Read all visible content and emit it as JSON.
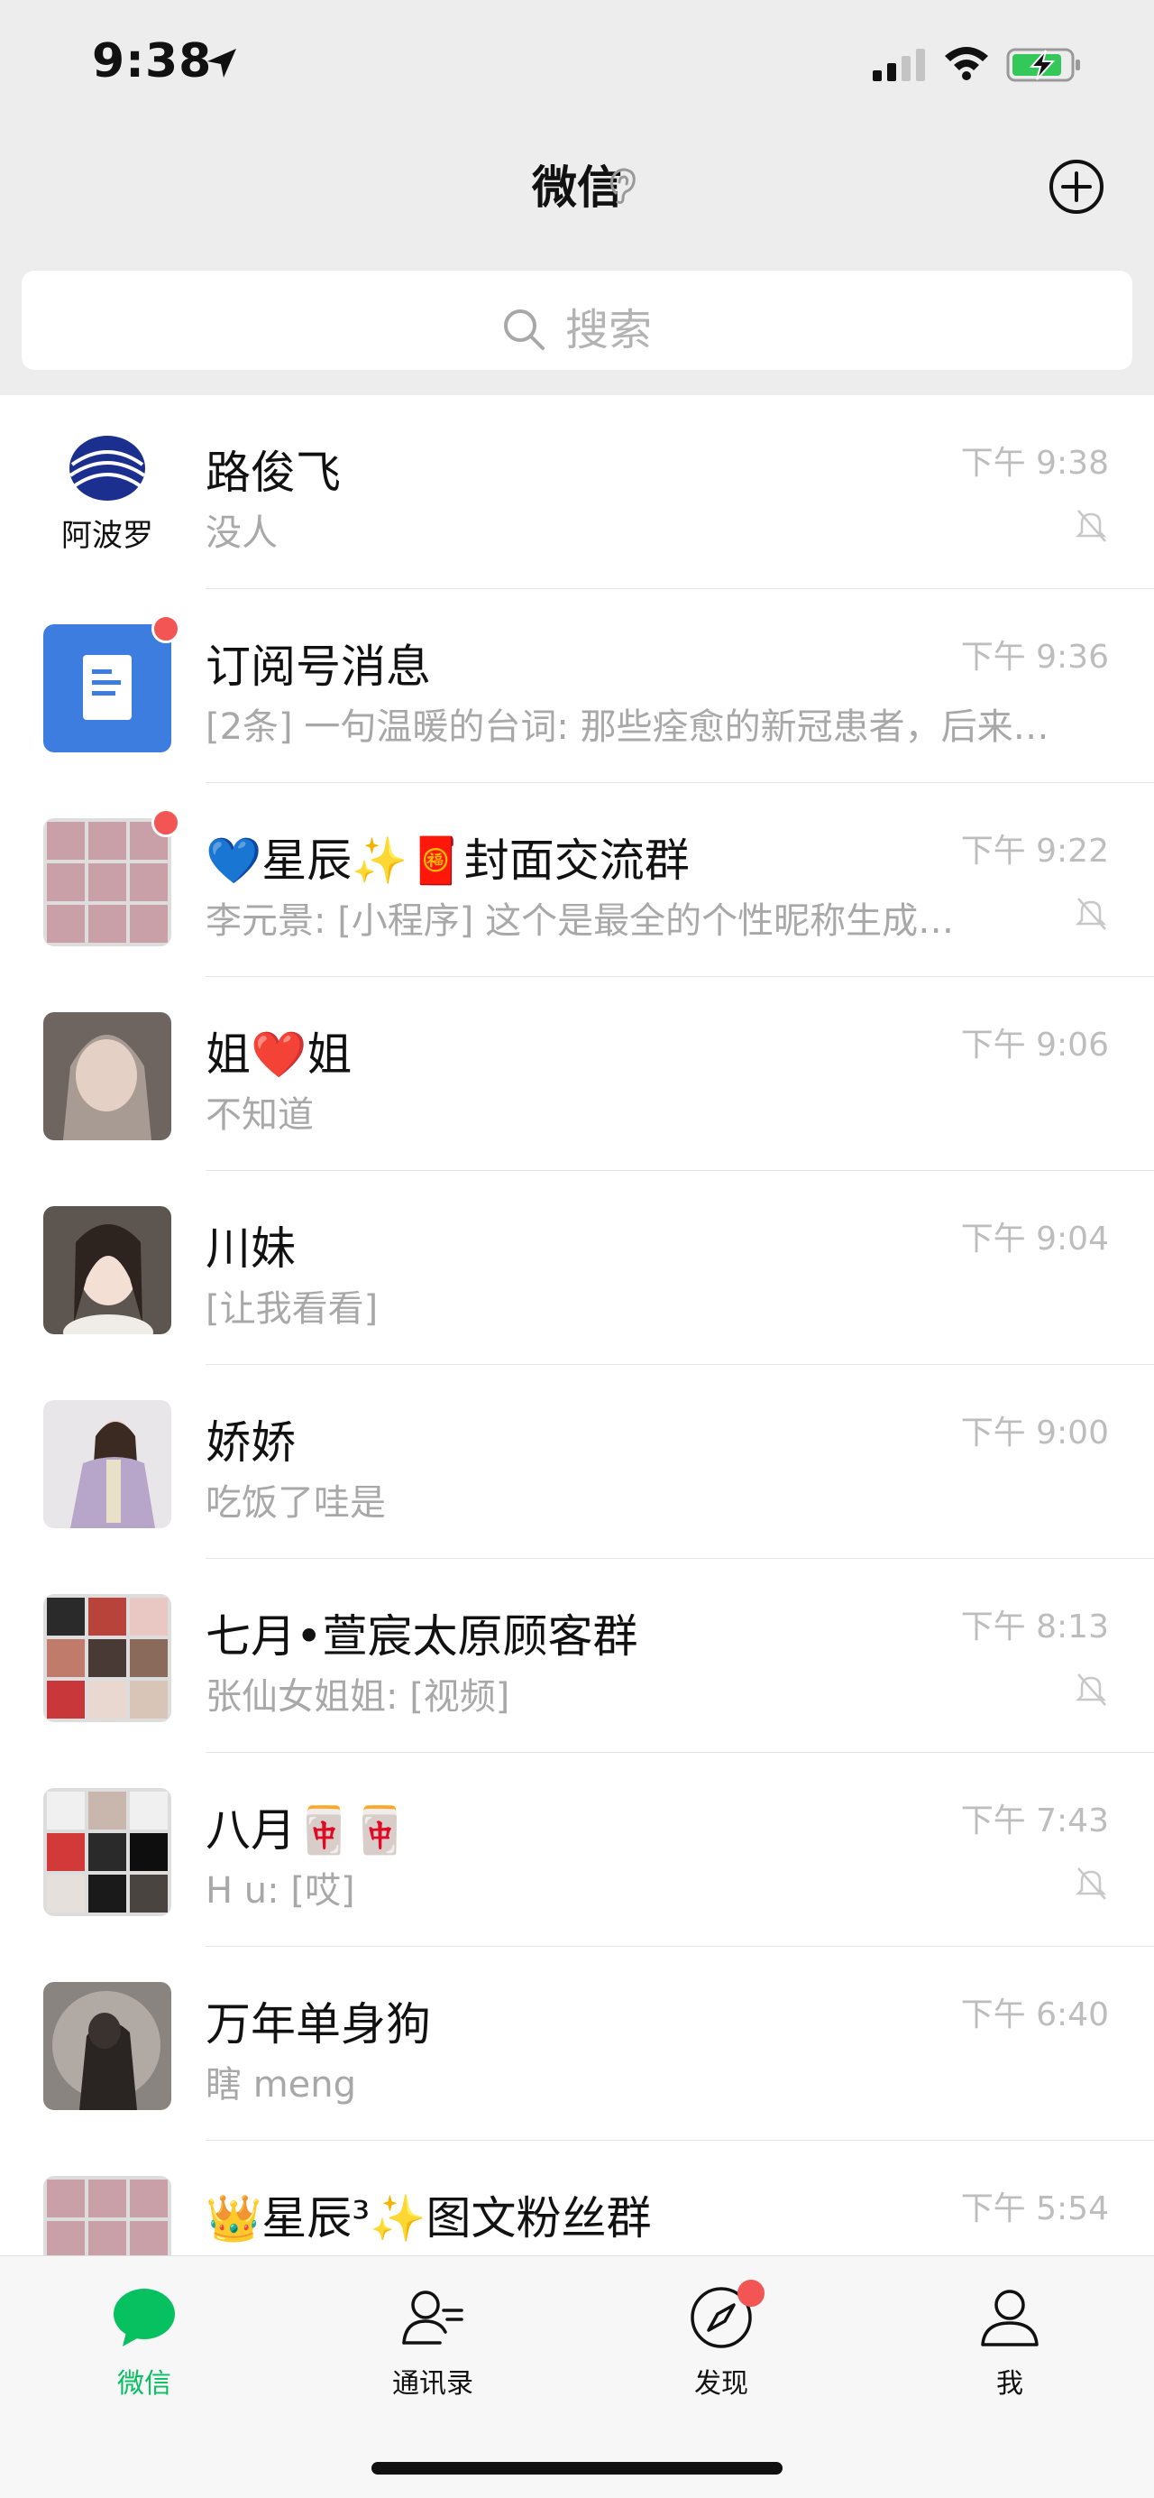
{
  "status_bar": {
    "time": "9:38"
  },
  "nav": {
    "title": "微信",
    "add_button": "add"
  },
  "search": {
    "placeholder": "搜索"
  },
  "chats": [
    {
      "name": "路俊飞",
      "preview": "没人",
      "time": "下午 9:38",
      "muted": true,
      "unread_dot": false,
      "avatar_label": "阿波罗"
    },
    {
      "name": "订阅号消息",
      "preview": "[2条] 一句温暖的台词: 那些痊愈的新冠患者，后来…",
      "time": "下午 9:36",
      "muted": false,
      "unread_dot": true
    },
    {
      "name": "星辰✨🧧封面交流群",
      "name_prefix": "💙",
      "preview": "李元景: [小程序] 这个是最全的个性昵称生成…",
      "time": "下午 9:22",
      "muted": true,
      "unread_dot": true
    },
    {
      "name": "姐❤️姐",
      "preview": " 不知道",
      "time": "下午 9:06",
      "muted": false,
      "unread_dot": false
    },
    {
      "name": "川妹",
      "preview": "[让我看看]",
      "time": "下午 9:04",
      "muted": false,
      "unread_dot": false
    },
    {
      "name": "娇娇",
      "preview": "吃饭了哇是",
      "time": "下午 9:00",
      "muted": false,
      "unread_dot": false
    },
    {
      "name": "七月•萱宸太原顾客群",
      "preview": "张仙女姐姐: [视频]",
      "time": "下午 8:13",
      "muted": true,
      "unread_dot": false
    },
    {
      "name": "八月🀄🀄",
      "preview": "H u: [哎]",
      "time": "下午 7:43",
      "muted": true,
      "unread_dot": false
    },
    {
      "name": "万年单身狗",
      "preview": "瞎 meng",
      "time": "下午 6:40",
      "muted": false,
      "unread_dot": false
    },
    {
      "name": "👑星辰³✨图文粉丝群",
      "preview": "",
      "time": "下午 5:54",
      "muted": false,
      "unread_dot": false
    }
  ],
  "tabs": [
    {
      "label": "微信",
      "active": true
    },
    {
      "label": "通讯录",
      "active": false
    },
    {
      "label": "发现",
      "active": false,
      "dot": true
    },
    {
      "label": "我",
      "active": false
    }
  ],
  "colors": {
    "accent": "#07c160",
    "badge": "#f25554",
    "background": "#ededed"
  }
}
